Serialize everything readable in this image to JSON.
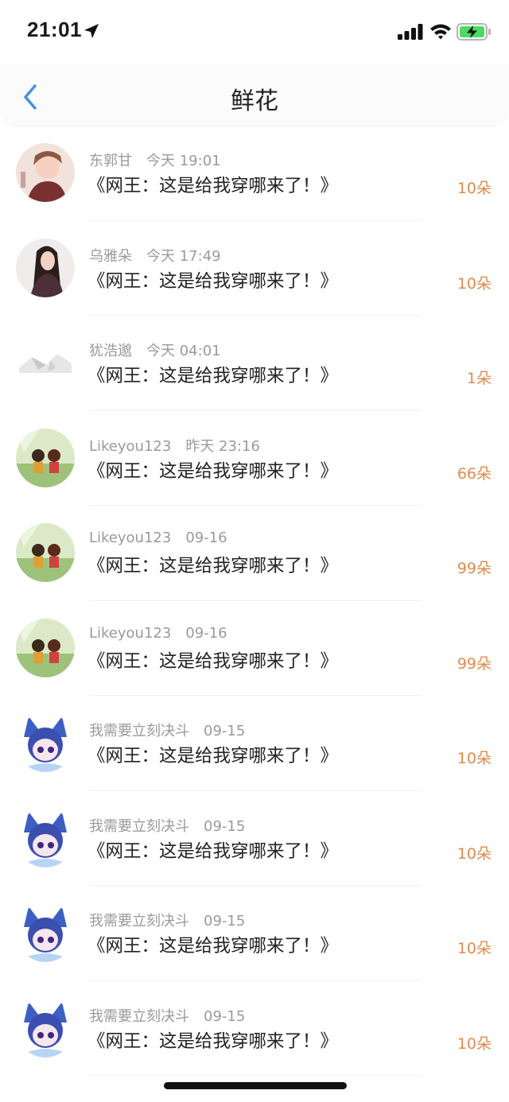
{
  "status": {
    "time": "21:01",
    "battery_color": "#4cd964"
  },
  "nav": {
    "title": "鲜花",
    "back_icon": "chevron-left-icon",
    "accent": "#4a90e2"
  },
  "colors": {
    "flower_count": "#e08a4d",
    "meta": "#9a9a9a"
  },
  "items": [
    {
      "user": "东郭甘",
      "time": "今天 19:01",
      "book": "《网王：这是给我穿哪来了！》",
      "count": "10朵",
      "avatar": "avatar-1"
    },
    {
      "user": "乌雅朵",
      "time": "今天 17:49",
      "book": "《网王：这是给我穿哪来了！》",
      "count": "10朵",
      "avatar": "avatar-2"
    },
    {
      "user": "犹浩邈",
      "time": "今天 04:01",
      "book": "《网王：这是给我穿哪来了！》",
      "count": "1朵",
      "avatar": "avatar-3"
    },
    {
      "user": "Likeyou123",
      "time": "昨天 23:16",
      "book": "《网王：这是给我穿哪来了！》",
      "count": "66朵",
      "avatar": "avatar-4"
    },
    {
      "user": "Likeyou123",
      "time": "09-16",
      "book": "《网王：这是给我穿哪来了！》",
      "count": "99朵",
      "avatar": "avatar-4"
    },
    {
      "user": "Likeyou123",
      "time": "09-16",
      "book": "《网王：这是给我穿哪来了！》",
      "count": "99朵",
      "avatar": "avatar-4"
    },
    {
      "user": "我需要立刻决斗",
      "time": "09-15",
      "book": "《网王：这是给我穿哪来了！》",
      "count": "10朵",
      "avatar": "avatar-5"
    },
    {
      "user": "我需要立刻决斗",
      "time": "09-15",
      "book": "《网王：这是给我穿哪来了！》",
      "count": "10朵",
      "avatar": "avatar-5"
    },
    {
      "user": "我需要立刻决斗",
      "time": "09-15",
      "book": "《网王：这是给我穿哪来了！》",
      "count": "10朵",
      "avatar": "avatar-5"
    },
    {
      "user": "我需要立刻决斗",
      "time": "09-15",
      "book": "《网王：这是给我穿哪来了！》",
      "count": "10朵",
      "avatar": "avatar-5"
    }
  ]
}
